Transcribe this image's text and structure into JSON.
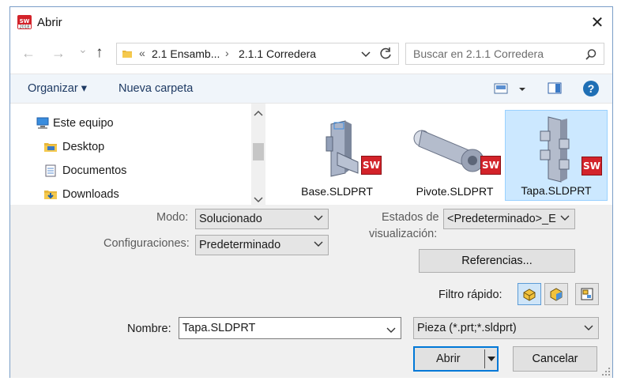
{
  "window": {
    "title": "Abrir",
    "close_glyph": "✕",
    "app_icon": "solidworks-2018-icon"
  },
  "nav": {
    "back": "←",
    "forward": "→",
    "recent": "⌄",
    "up": "↑"
  },
  "address": {
    "overflow": "«",
    "crumbs": [
      "2.1 Ensamb...",
      "2.1.1 Corredera"
    ],
    "separator": "›"
  },
  "search": {
    "placeholder": "Buscar en 2.1.1 Corredera"
  },
  "toolbar": {
    "organize": "Organizar ▾",
    "new_folder": "Nueva carpeta",
    "help": "?"
  },
  "navpane": {
    "items": [
      "Este equipo",
      "Desktop",
      "Documentos",
      "Downloads"
    ]
  },
  "files": [
    {
      "name": "Base.SLDPRT",
      "selected": false
    },
    {
      "name": "Pivote.SLDPRT",
      "selected": false
    },
    {
      "name": "Tapa.SLDPRT",
      "selected": true
    }
  ],
  "badge": "SW",
  "options": {
    "mode_label": "Modo:",
    "mode_value": "Solucionado",
    "config_label": "Configuraciones:",
    "config_value": "Predeterminado",
    "display_states_label_1": "Estados de",
    "display_states_label_2": "visualización:",
    "display_states_value": "<Predeterminado>_E",
    "references_button": "Referencias...",
    "quick_filter_label": "Filtro rápido:"
  },
  "footer": {
    "name_label": "Nombre:",
    "name_value": "Tapa.SLDPRT",
    "type_value": "Pieza (*.prt;*.sldprt)",
    "open_button": "Abrir",
    "cancel_button": "Cancelar"
  },
  "colors": {
    "accent": "#1f6fb5",
    "selection": "#cce8ff",
    "selection_border": "#99d1ff",
    "sw_red": "#d3232a"
  }
}
